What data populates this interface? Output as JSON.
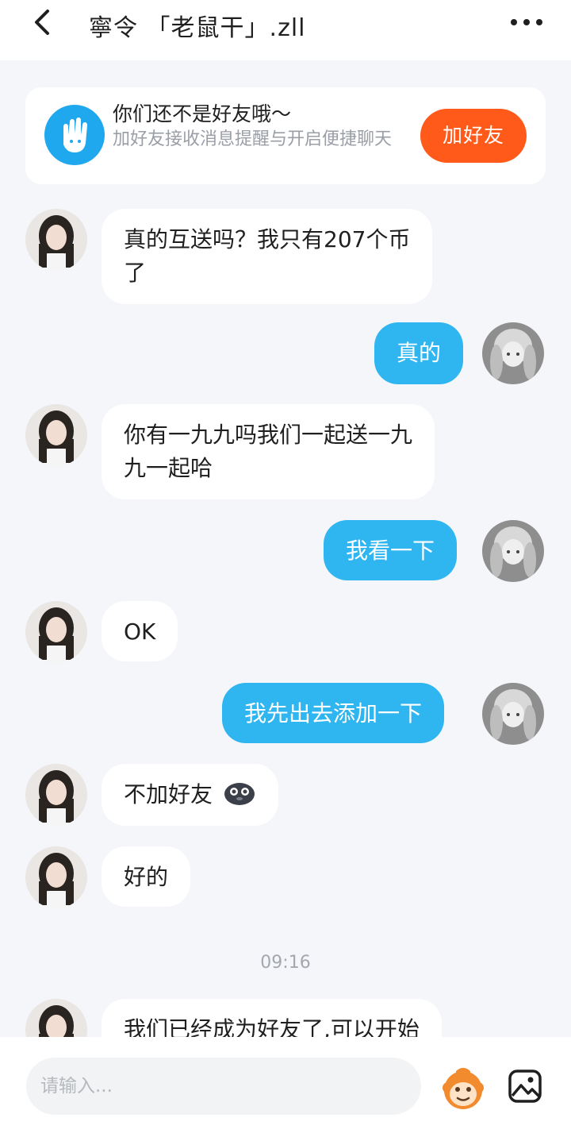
{
  "header": {
    "title": "寧令 「老鼠干」.zll"
  },
  "banner": {
    "title": "你们还不是好友哦～",
    "subtitle": "加好友接收消息提醒与开启便捷聊天",
    "button_label": "加好友"
  },
  "messages": [
    {
      "side": "left",
      "text_lines": [
        "真的互送吗？我只有207个币",
        "了"
      ]
    },
    {
      "side": "right",
      "text_lines": [
        "真的"
      ]
    },
    {
      "side": "left",
      "text_lines": [
        "你有一九九吗我们一起送一九",
        "九一起哈"
      ]
    },
    {
      "side": "right",
      "text_lines": [
        "我看一下"
      ]
    },
    {
      "side": "left",
      "text_lines": [
        "OK"
      ]
    },
    {
      "side": "right",
      "text_lines": [
        "我先出去添加一下"
      ]
    },
    {
      "side": "left",
      "text_lines": [
        "不加好友"
      ]
    },
    {
      "side": "left",
      "text_lines": [
        "好的"
      ]
    },
    {
      "side": "left",
      "text_lines": [
        "我们已经成为好友了,可以开始"
      ]
    }
  ],
  "timestamp": "09:16",
  "composer": {
    "placeholder": "请输入..."
  },
  "colors": {
    "accent": "#2fb6f0",
    "add_button": "#ff5a1a",
    "background": "#f4f6fa"
  },
  "icons": {
    "back": "chevron-left-icon",
    "more": "more-dots-icon",
    "banner": "hand-wave-icon",
    "emoji": "monkey-emoji-icon",
    "image": "image-icon"
  }
}
